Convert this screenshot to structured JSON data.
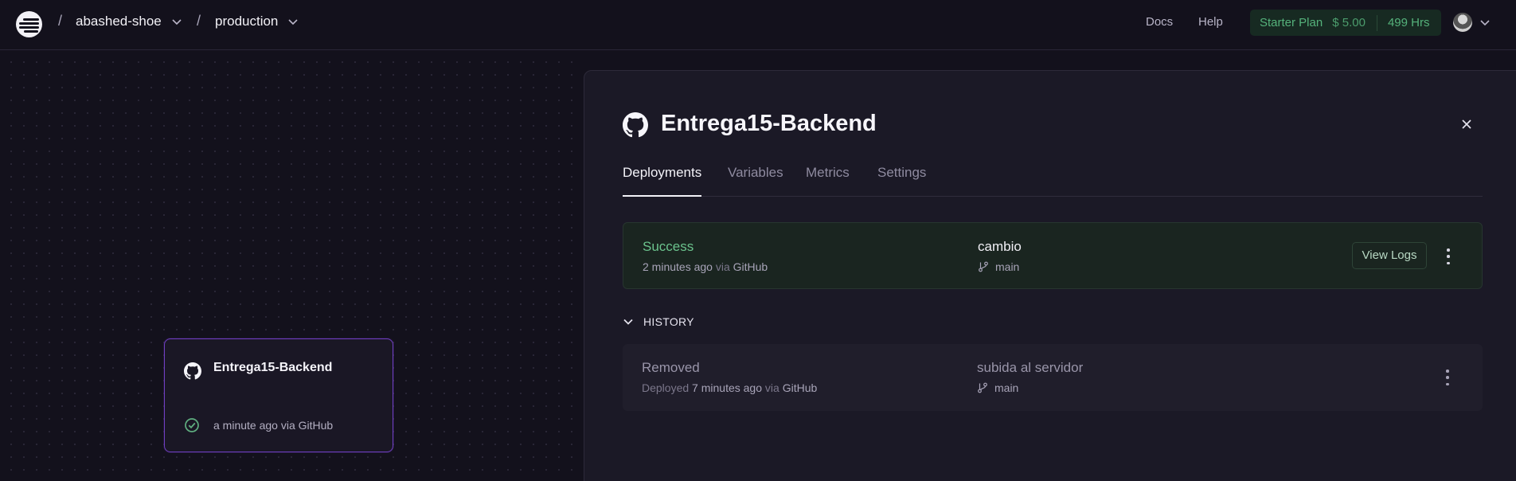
{
  "topbar": {
    "project": "abashed-shoe",
    "environment": "production",
    "docs": "Docs",
    "help": "Help",
    "plan": {
      "name": "Starter Plan",
      "price": "$ 5.00",
      "hours": "499 Hrs"
    },
    "separator": "/"
  },
  "canvas": {
    "service_card": {
      "title": "Entrega15-Backend",
      "meta": "a minute ago via GitHub"
    }
  },
  "panel": {
    "title": "Entrega15-Backend",
    "tabs": [
      {
        "label": "Deployments",
        "active": true
      },
      {
        "label": "Variables",
        "active": false
      },
      {
        "label": "Metrics",
        "active": false
      },
      {
        "label": "Settings",
        "active": false
      }
    ],
    "current_deployment": {
      "status": "Success",
      "time": "2 minutes ago",
      "via_word": "via",
      "source": "GitHub",
      "commit": "cambio",
      "branch": "main",
      "view_logs": "View Logs"
    },
    "history_label": "HISTORY",
    "history": [
      {
        "status": "Removed",
        "prefix": "Deployed",
        "time": "7 minutes ago",
        "via_word": "via",
        "source": "GitHub",
        "commit": "subida al servidor",
        "branch": "main"
      }
    ]
  },
  "colors": {
    "background": "#13111c",
    "accent_purple": "#6f3fc2",
    "success_green": "#6bc38d",
    "plan_green": "#55b27b"
  },
  "icons": [
    "railway-logo-icon",
    "chevron-down-icon",
    "github-icon",
    "check-circle-icon",
    "close-icon",
    "git-branch-icon",
    "kebab-menu-icon",
    "avatar"
  ]
}
